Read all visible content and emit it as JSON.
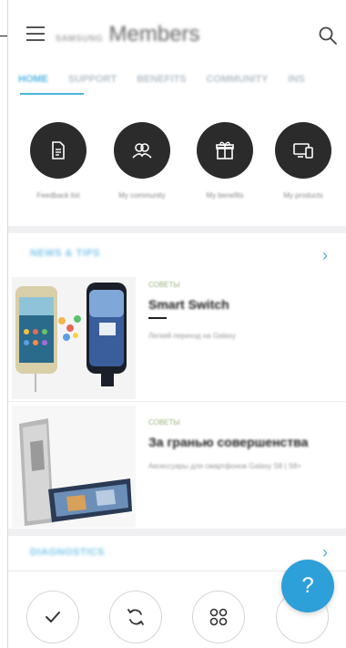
{
  "appbar": {
    "brand_small": "SAMSUNG",
    "brand_main": "Members",
    "menu_icon": "hamburger-icon",
    "search_icon": "search-icon"
  },
  "tabs": [
    {
      "label": "HOME",
      "active": true
    },
    {
      "label": "SUPPORT",
      "active": false
    },
    {
      "label": "BENEFITS",
      "active": false
    },
    {
      "label": "COMMUNITY",
      "active": false
    },
    {
      "label": "INS",
      "active": false
    }
  ],
  "quick_actions": [
    {
      "label": "Feedback list",
      "icon": "document-icon"
    },
    {
      "label": "My community",
      "icon": "people-icon"
    },
    {
      "label": "My benefits",
      "icon": "gift-icon"
    },
    {
      "label": "My products",
      "icon": "devices-icon"
    }
  ],
  "news": {
    "title": "NEWS & TIPS",
    "chevron": "›",
    "cards": [
      {
        "tag": "СОВЕТЫ",
        "title": "Smart Switch",
        "desc": "Легкий переход на Galaxy"
      },
      {
        "tag": "СОВЕТЫ",
        "title": "За гранью совершенства",
        "desc": "Аксессуары для смартфонов Galaxy S8 | S8+"
      }
    ]
  },
  "diagnostics": {
    "title": "DIAGNOSTICS",
    "chevron": "›"
  },
  "bottom_bar": {
    "buttons": [
      "check-icon",
      "refresh-icon",
      "apps-icon",
      "partial-button"
    ],
    "fab_label": "?"
  },
  "colors": {
    "accent": "#2d9fd9",
    "dark_circle": "#2b2b2b",
    "tab_active": "#5ab7e3"
  }
}
